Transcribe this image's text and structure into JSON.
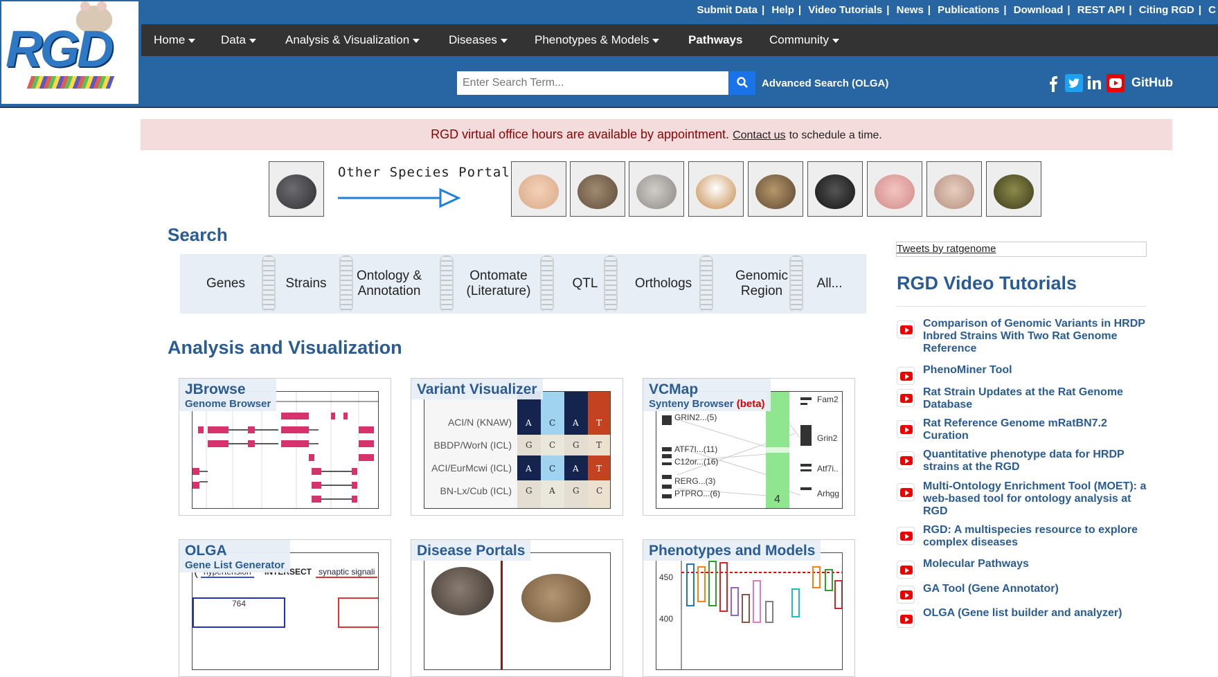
{
  "logo": {
    "text": "RGD"
  },
  "top_links": [
    "Submit Data",
    "Help",
    "Video Tutorials",
    "News",
    "Publications",
    "Download",
    "REST API",
    "Citing RGD",
    "C"
  ],
  "nav": {
    "home": "Home",
    "data": "Data",
    "analysis": "Analysis & Visualization",
    "diseases": "Diseases",
    "phenotypes": "Phenotypes & Models",
    "pathways": "Pathways",
    "community": "Community"
  },
  "search": {
    "placeholder": "Enter Search Term...",
    "advanced": "Advanced Search (OLGA)"
  },
  "social": {
    "github": "GitHub",
    "icons": [
      "facebook-icon",
      "twitter-icon",
      "linkedin-icon",
      "youtube-icon"
    ]
  },
  "notice": {
    "main": "RGD virtual office hours are available by appointment.",
    "link": "Contact us",
    "rest": "to schedule a time."
  },
  "portals": {
    "label": "Other Species Portals"
  },
  "search_section": {
    "title": "Search",
    "items": [
      "Genes",
      "Strains",
      "Ontology & Annotation",
      "Ontomate (Literature)",
      "QTL",
      "Orthologs",
      "Genomic Region",
      "All..."
    ]
  },
  "analysis": {
    "title": "Analysis and Visualization",
    "cards": [
      {
        "title": "JBrowse",
        "subtitle": "Genome Browser"
      },
      {
        "title": "Variant Visualizer",
        "subtitle": ""
      },
      {
        "title": "VCMap",
        "subtitle": "Synteny Browser",
        "badge": "(beta)"
      },
      {
        "title": "OLGA",
        "subtitle": "Gene List Generator"
      },
      {
        "title": "Disease Portals",
        "subtitle": ""
      },
      {
        "title": "Phenotypes and Models",
        "subtitle": ""
      }
    ],
    "variant_rows": [
      "ACI/N (KNAW)",
      "BBDP/WorN (ICL)",
      "ACI/EurMcwi (ICL)",
      "BN-Lx/Cub (ICL)"
    ],
    "variant_cols": [
      [
        "A",
        "C",
        "A",
        "T"
      ],
      [
        "G",
        "C",
        "G",
        "T"
      ],
      [
        "A",
        "C",
        "A",
        "T"
      ],
      [
        "G",
        "A",
        "G",
        "C"
      ]
    ],
    "vcmap_labels": [
      "GRIN2...(5)",
      "ATF7I...(11)",
      "C12or...(16)",
      "RERG...(3)",
      "PTPRO...(6)",
      "Fam2",
      "Grin2",
      "Atf7i..",
      "Arhgg"
    ],
    "olga_terms": [
      "hypertension",
      "INTERSECT",
      "synaptic signali",
      "764"
    ],
    "pheno_ticks": [
      "450",
      "400"
    ]
  },
  "sidebar": {
    "tweets": "Tweets by ratgenome",
    "videos_title": "RGD Video Tutorials",
    "videos": [
      "Comparison of Genomic Variants in HRDP Inbred Strains With Two Rat Genome Reference",
      "PhenoMiner Tool",
      "Rat Strain Updates at the Rat Genome Database",
      "Rat Reference Genome mRatBN7.2 Curation",
      "Quantitative phenotype data for HRDP strains at the RGD",
      "Multi-Ontology Enrichment Tool (MOET): a web-based tool for ontology analysis at RGD",
      "RGD: A multispecies resource to explore complex diseases",
      "Molecular Pathways",
      "GA Tool (Gene Annotator)",
      "OLGA (Gene list builder and analyzer)"
    ]
  }
}
